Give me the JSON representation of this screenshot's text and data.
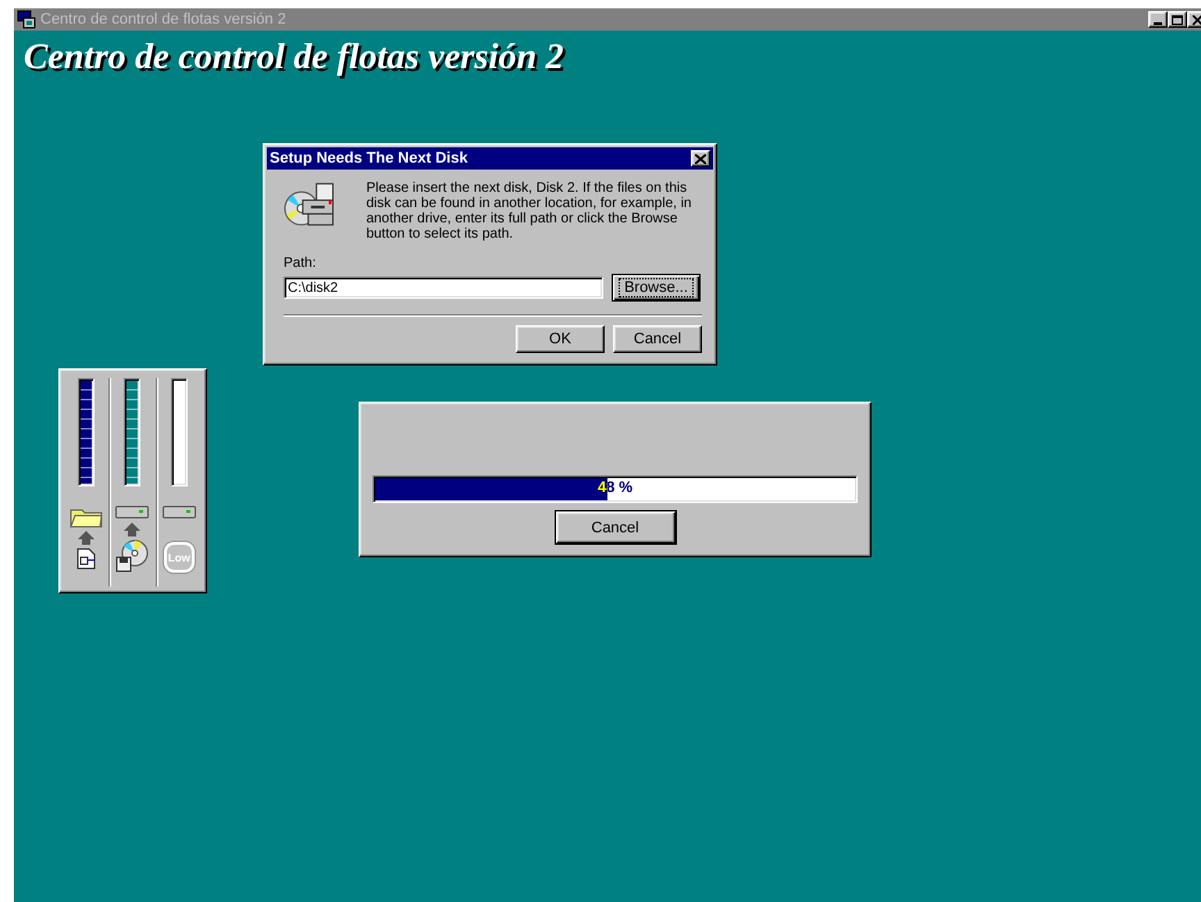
{
  "window": {
    "title": "Centro de control de flotas versión 2"
  },
  "heading": "Centro de control de flotas versión 2",
  "disk_dialog": {
    "title": "Setup Needs The Next Disk",
    "message": "Please insert the next disk, Disk 2. If the files on this disk can be found in another location, for example, in another drive, enter its full path or click the Browse button to select its path.",
    "path_label": "Path:",
    "path_value": "C:\\disk2",
    "buttons": [
      {
        "kind": "browse",
        "label": "Browse...",
        "focused": true
      },
      {
        "kind": "ok",
        "label": "OK",
        "focused": false
      },
      {
        "kind": "cancel",
        "label": "Cancel",
        "focused": false
      }
    ]
  },
  "meters": [
    {
      "level": 1,
      "color": "#000080"
    },
    {
      "level": 1,
      "color": "#008080"
    },
    {
      "level": 0,
      "badge": "Low"
    }
  ],
  "progress": {
    "level": 0.48,
    "reading": "48 %",
    "button": "Cancel"
  }
}
